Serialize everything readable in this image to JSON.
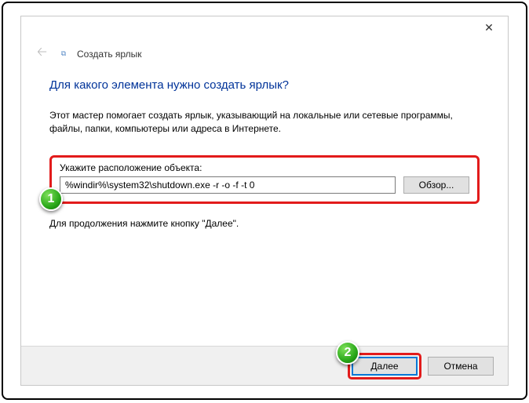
{
  "window": {
    "title": "Создать ярлык"
  },
  "heading": "Для какого элемента нужно создать ярлык?",
  "description": "Этот мастер помогает создать ярлык, указывающий на локальные или сетевые программы, файлы, папки, компьютеры или адреса в Интернете.",
  "field": {
    "label": "Укажите расположение объекта:",
    "value": "%windir%\\system32\\shutdown.exe -r -o -f -t 0"
  },
  "buttons": {
    "browse": "Обзор...",
    "next": "Далее",
    "cancel": "Отмена"
  },
  "continue_hint": "Для продолжения нажмите кнопку \"Далее\".",
  "annotations": {
    "badge1": "1",
    "badge2": "2"
  }
}
